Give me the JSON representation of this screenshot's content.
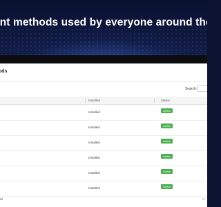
{
  "banner": {
    "headline": "ent methods used by everyone around the"
  },
  "app": {
    "page_title": "ods",
    "search": {
      "label": "Search:",
      "value": ""
    },
    "table": {
      "columns": [
        "",
        "Installed",
        "Status"
      ],
      "rows": [
        {
          "installed": "Installed",
          "status": "Active"
        },
        {
          "installed": "Installed",
          "status": "Active"
        },
        {
          "installed": "Installed",
          "status": "Active"
        },
        {
          "installed": "Installed",
          "status": "Active"
        },
        {
          "installed": "Installed",
          "status": "Active"
        },
        {
          "installed": "Installed",
          "status": "Active"
        }
      ]
    },
    "footer": {
      "entries_text": "ries",
      "pagination_text": "Pr"
    }
  },
  "colors": {
    "banner_bg": "#0b1330",
    "active_badge": "#4caf50"
  },
  "icons": []
}
